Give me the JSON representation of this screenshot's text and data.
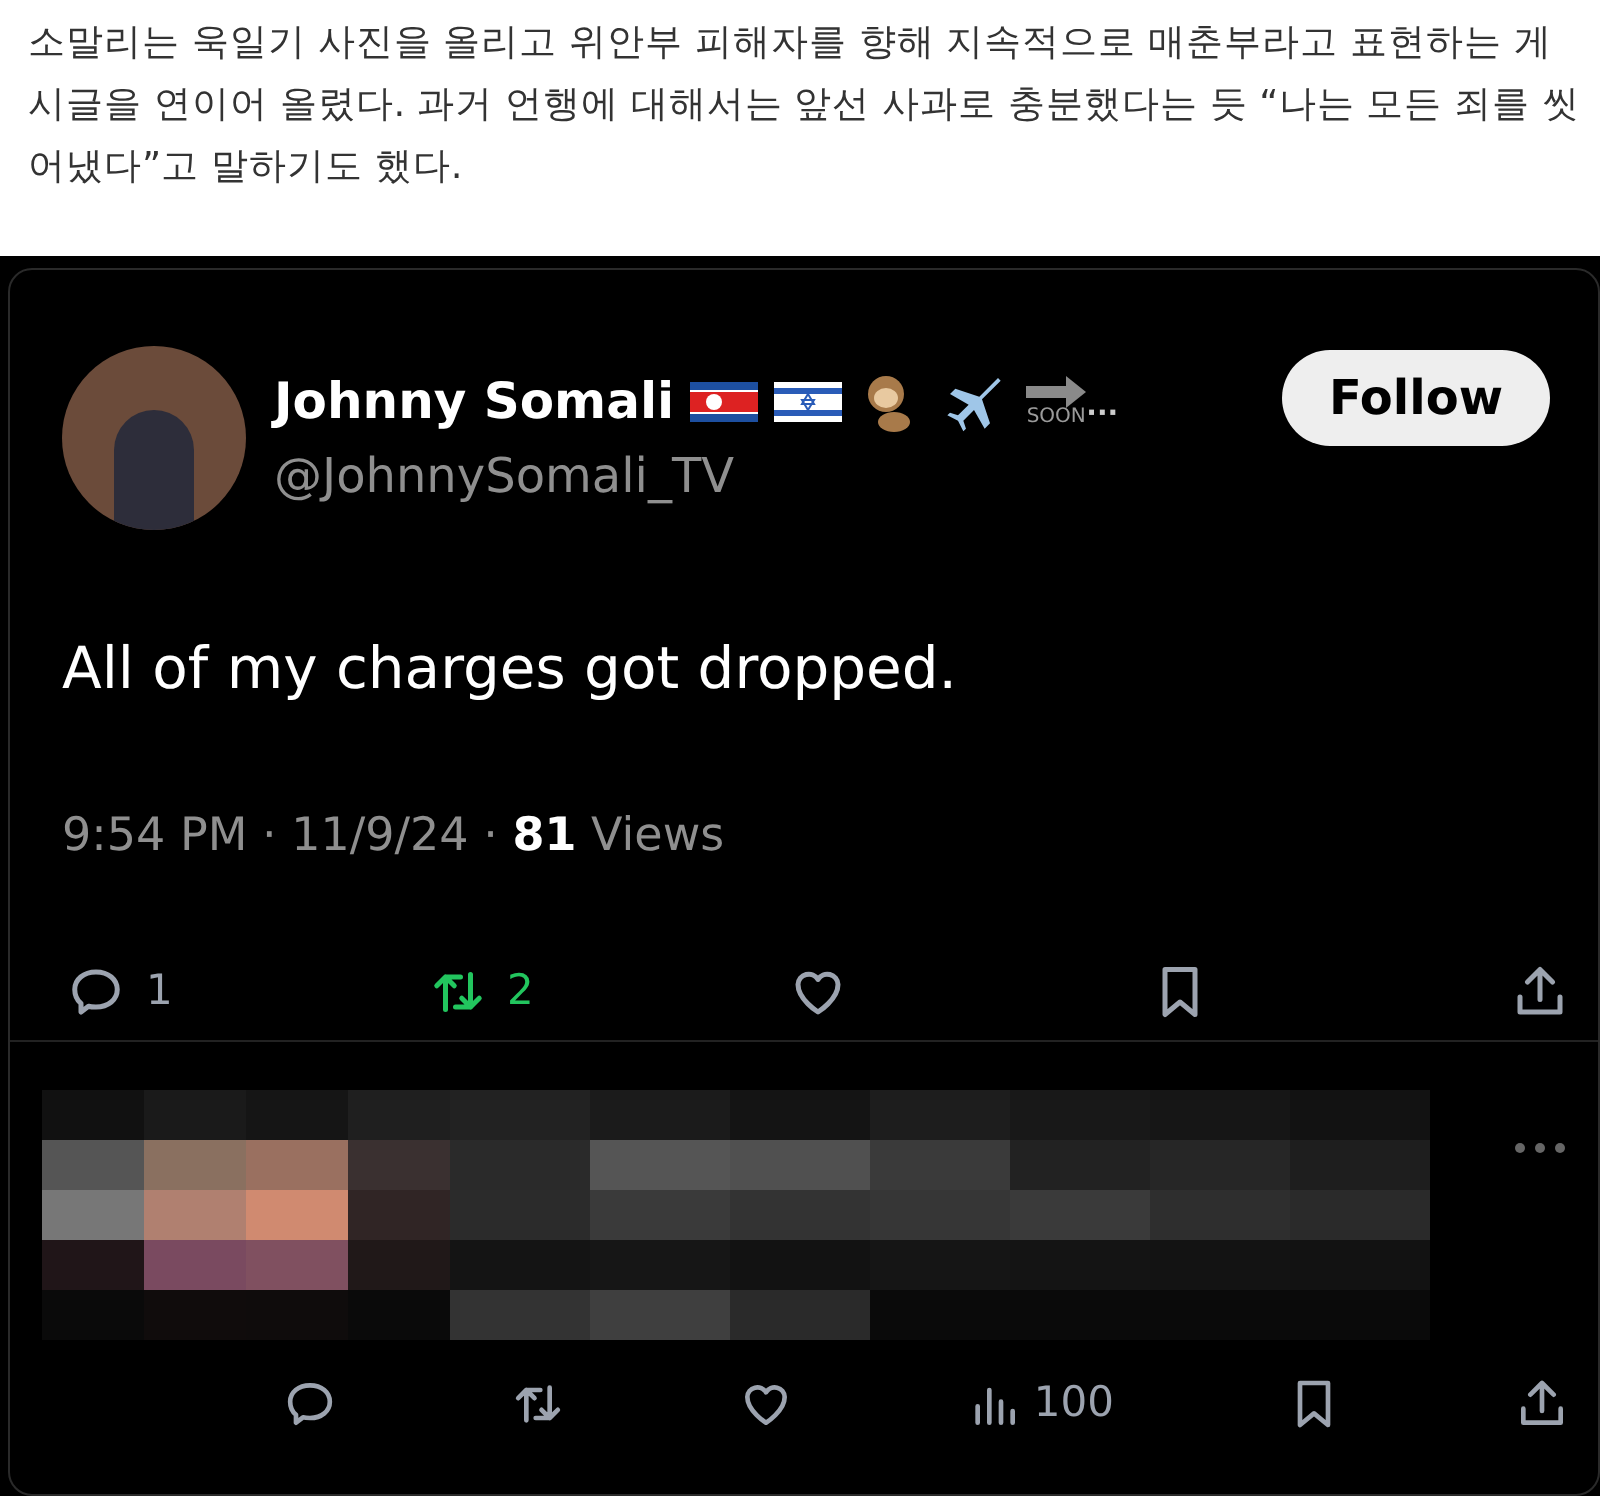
{
  "article": {
    "paragraph": "소말리는 욱일기 사진을 올리고 위안부 피해자를 향해 지속적으로 매춘부라고 표현하는 게시글을 연이어 올렸다. 과거 언행에 대해서는 앞선 사과로 충분했다는 듯 “나는 모든 죄를 씻어냈다”고 말하기도 했다."
  },
  "tweet": {
    "name": "Johnny Somali",
    "soon_label": "SOON",
    "name_ellipsis": "···",
    "handle": "@JohnnySomali_TV",
    "follow_button": "Follow",
    "text": "All of my charges got dropped.",
    "time": "9:54 PM · 11/9/24 · ",
    "views_count": "81",
    "views_label": " Views",
    "actions": [
      {
        "kind": "reply",
        "count": "1",
        "active": false
      },
      {
        "kind": "retweet",
        "count": "2",
        "active": true
      },
      {
        "kind": "like",
        "active": false
      },
      {
        "kind": "bookmark",
        "active": false
      },
      {
        "kind": "share",
        "active": false
      }
    ]
  },
  "reply": {
    "actions": [
      {
        "kind": "reply"
      },
      {
        "kind": "retweet"
      },
      {
        "kind": "like"
      },
      {
        "kind": "views",
        "count": "100"
      },
      {
        "kind": "bookmark"
      },
      {
        "kind": "share"
      }
    ]
  }
}
